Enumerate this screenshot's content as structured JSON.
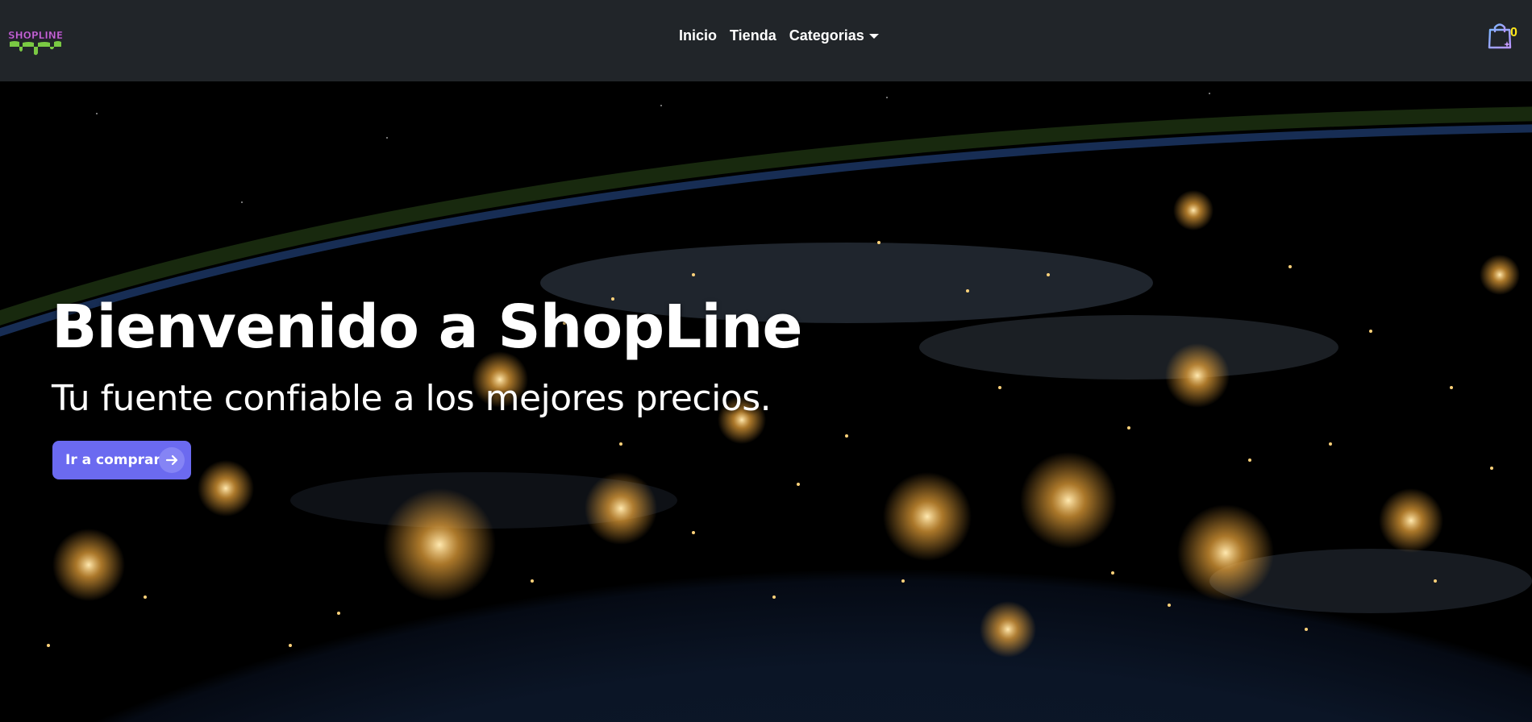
{
  "nav": {
    "logo_text": "SHOPLINE",
    "links": [
      {
        "label": "Inicio"
      },
      {
        "label": "Tienda"
      },
      {
        "label": "Categorias"
      }
    ],
    "cart_count": "0"
  },
  "hero": {
    "title": "Bienvenido a ShopLine",
    "subtitle": "Tu fuente confiable a los mejores precios.",
    "cta_label": "Ir a comprar"
  },
  "colors": {
    "navbar_bg": "#212529",
    "accent_button": "#6b6af0",
    "cart_count": "#ffe81a"
  },
  "icons": {
    "logo": "shopline-logo",
    "cart": "shopping-bag-icon",
    "cta": "arrow-right-icon",
    "dropdown": "caret-down-icon"
  }
}
